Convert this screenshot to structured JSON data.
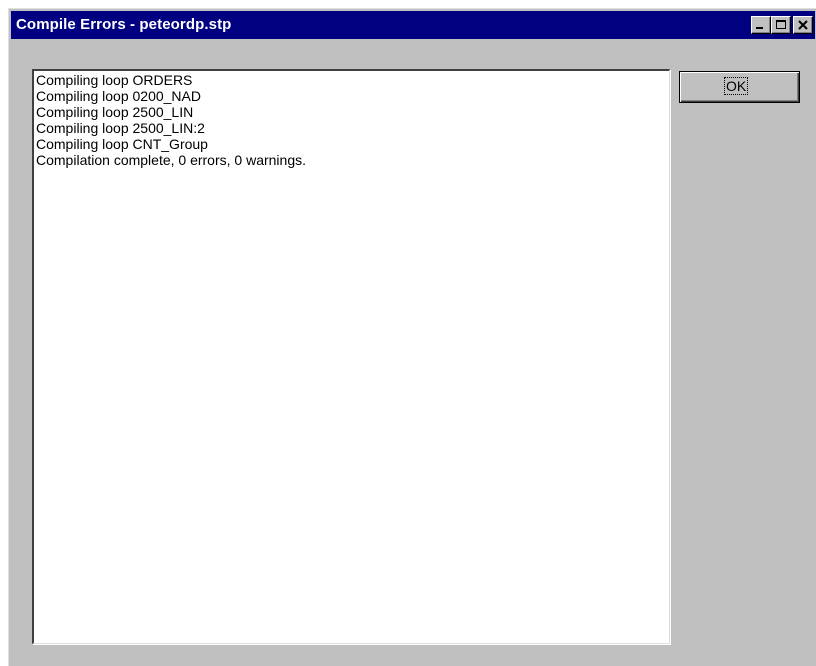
{
  "window": {
    "title": "Compile Errors - peteordp.stp",
    "controls": [
      "minimize-icon",
      "maximize-icon",
      "close-icon"
    ]
  },
  "output": {
    "lines": [
      "Compiling loop ORDERS",
      "Compiling loop 0200_NAD",
      "Compiling loop 2500_LIN",
      "Compiling loop 2500_LIN:2",
      "Compiling loop CNT_Group",
      "Compilation complete, 0 errors, 0 warnings."
    ]
  },
  "buttons": {
    "ok_label": "OK"
  },
  "colors": {
    "titlebar": "#000080",
    "window_face": "#c0c0c0",
    "output_background": "#ffffff"
  }
}
